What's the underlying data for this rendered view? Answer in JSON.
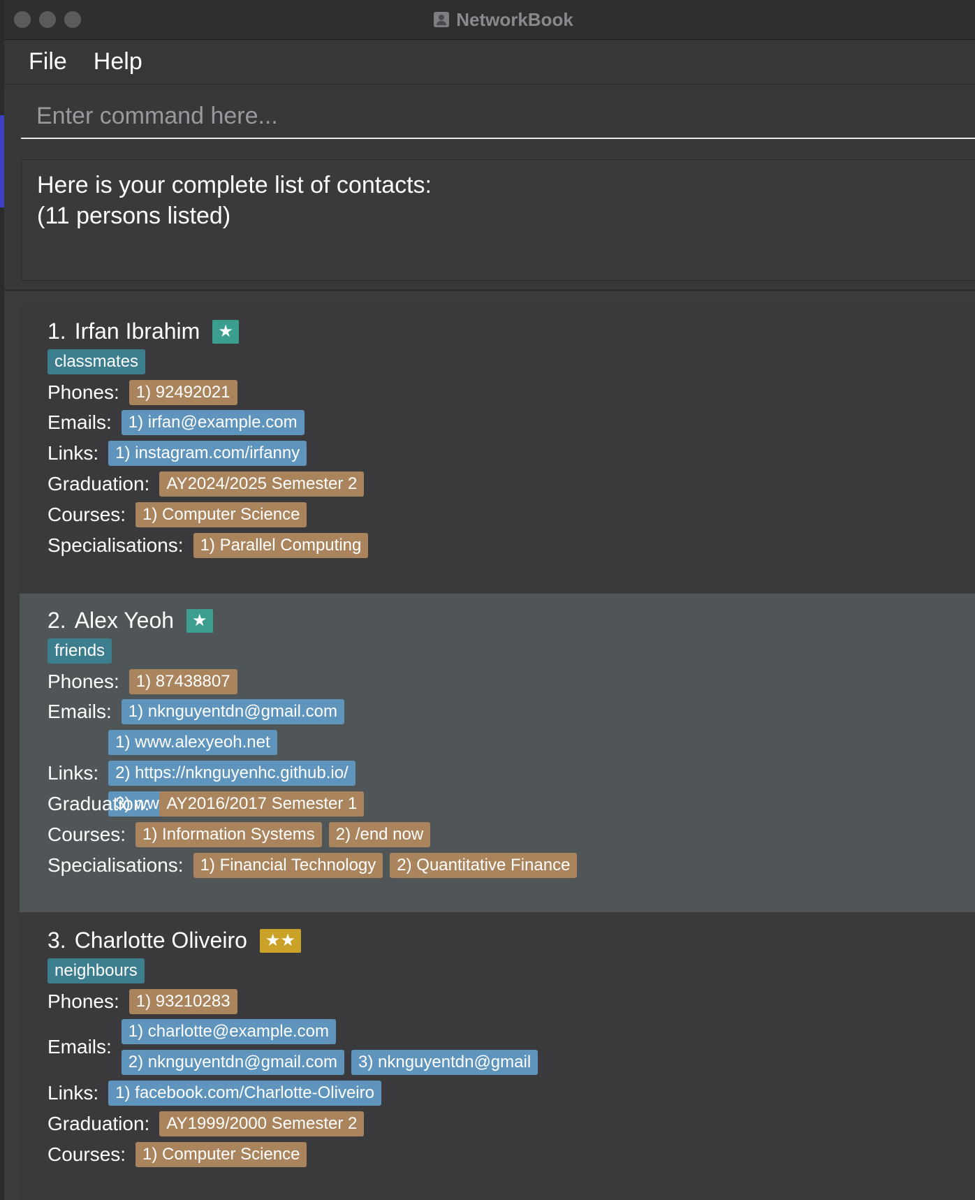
{
  "window": {
    "title": "NetworkBook"
  },
  "menu": {
    "file": "File",
    "help": "Help"
  },
  "command": {
    "placeholder": "Enter command here..."
  },
  "result": {
    "line1": "Here is your complete list of contacts:",
    "line2": "(11 persons listed)"
  },
  "labels": {
    "phones": "Phones:",
    "emails": "Emails:",
    "links": "Links:",
    "graduation": "Graduation:",
    "courses": "Courses:",
    "specialisations": "Specialisations:"
  },
  "colors": {
    "tag": "#3d7e8e",
    "orange_chip": "#aa845c",
    "blue_chip": "#5f95bd",
    "star_teal": "#3b9e8f",
    "star_gold": "#c9a227"
  },
  "contacts": [
    {
      "index": "1.",
      "name": "Irfan Ibrahim",
      "stars": "★",
      "tag": "classmates",
      "phones": [
        "1) 92492021"
      ],
      "emails": [
        "1) irfan@example.com"
      ],
      "links": [
        "1) instagram.com/irfanny"
      ],
      "graduation": "AY2024/2025 Semester 2",
      "courses": [
        "1) Computer Science"
      ],
      "specialisations": [
        "1) Parallel Computing"
      ]
    },
    {
      "index": "2.",
      "name": "Alex Yeoh",
      "stars": "★",
      "tag": "friends",
      "phones": [
        "1) 87438807"
      ],
      "emails": [
        "1) nknguyentdn@gmail.com"
      ],
      "links": [
        "1) www.alexyeoh.net",
        "2) https://nknguyenhc.github.io/",
        "3) www.nknguyentdngmail.com"
      ],
      "graduation": "AY2016/2017 Semester 1",
      "courses": [
        "1) Information Systems",
        "2) /end now"
      ],
      "specialisations": [
        "1) Financial Technology",
        "2) Quantitative Finance"
      ]
    },
    {
      "index": "3.",
      "name": "Charlotte Oliveiro",
      "stars": "★★",
      "tag": "neighbours",
      "phones": [
        "1) 93210283"
      ],
      "emails": [
        "1) charlotte@example.com",
        "2) nknguyentdn@gmail.com",
        "3) nknguyentdn@gmail"
      ],
      "links": [
        "1) facebook.com/Charlotte-Oliveiro"
      ],
      "graduation": "AY1999/2000 Semester 2",
      "courses": [
        "1) Computer Science"
      ]
    }
  ]
}
